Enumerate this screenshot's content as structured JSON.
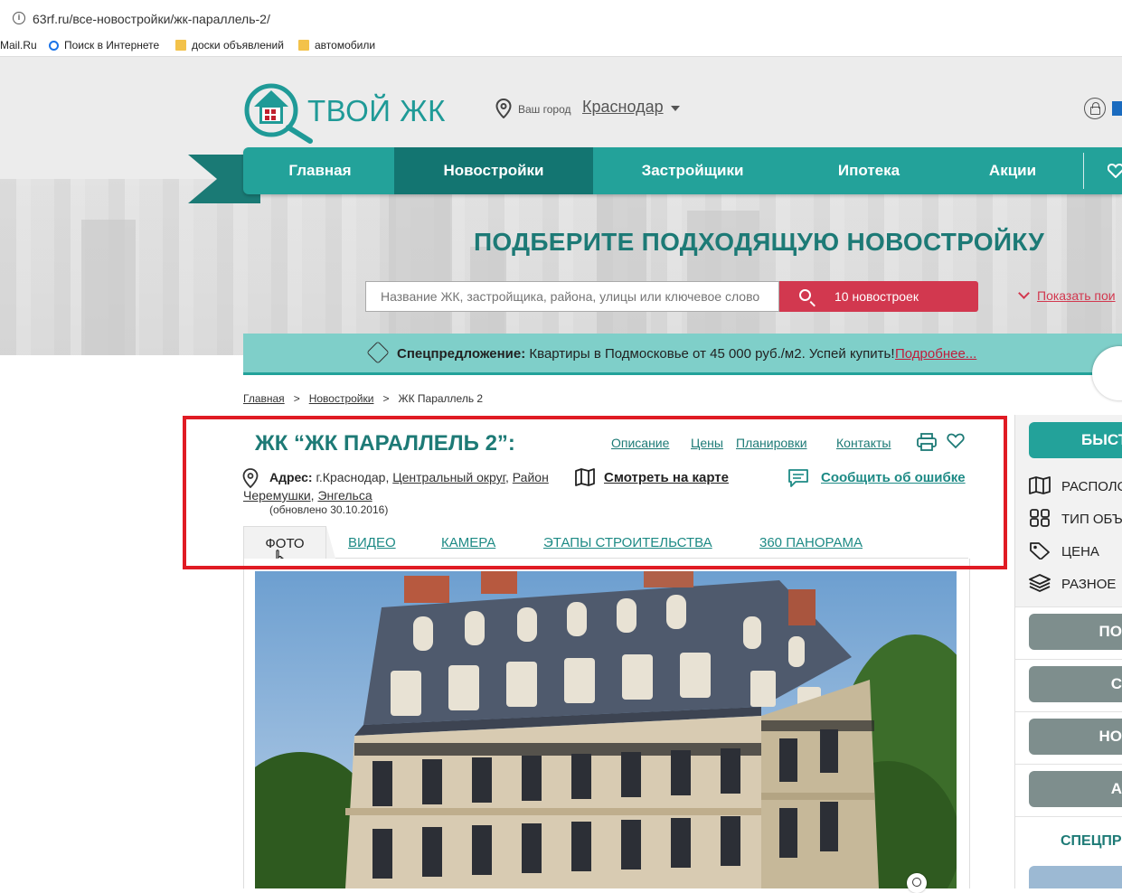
{
  "browser": {
    "url": "63rf.ru/все-новостройки/жк-параллель-2/",
    "bookmarks": [
      "Mail.Ru",
      "Поиск в Интернете",
      "доски объявлений",
      "автомобили"
    ]
  },
  "header": {
    "logo_text": "ТВОЙ ЖК",
    "city_label": "Ваш город",
    "city_name": "Краснодар"
  },
  "nav": {
    "items": [
      "Главная",
      "Новостройки",
      "Застройщики",
      "Ипотека",
      "Акции"
    ],
    "active": "Новостройки"
  },
  "hero": {
    "title": "ПОДБЕРИТЕ ПОДХОДЯЩУЮ НОВОСТРОЙКУ",
    "search_placeholder": "Название ЖК, застройщика, района, улицы или ключевое слово",
    "search_button": "10 новостроек",
    "show_more": "Показать пои"
  },
  "special": {
    "label": "Спецпредложение:",
    "text": " Квартиры в Подмосковье от 45 000 руб./м2. Успей купить!",
    "link": "Подробнее..."
  },
  "breadcrumb": [
    "Главная",
    "Новостройки",
    "ЖК Параллель 2"
  ],
  "complex": {
    "title": "ЖК “ЖК ПАРАЛЛЕЛЬ 2”:",
    "links": [
      "Описание",
      "Цены",
      "Планировки",
      "Контакты"
    ],
    "address_label": "Адрес:",
    "address_city": " г.Краснодар, ",
    "address_district": "Центральный округ",
    "address_area1": "Район",
    "address_area2": "Черемушки",
    "address_street": "Энгельса",
    "updated": "(обновлено 30.10.2016)",
    "map_link": "Смотреть на карте",
    "error_link": "Сообщить об ошибке"
  },
  "tabs": [
    "ФОТО",
    "ВИДЕО",
    "КАМЕРА",
    "ЭТАПЫ СТРОИТЕЛЬСТВА",
    "360 ПАНОРАМА"
  ],
  "sidebar": {
    "top_button": "БЫСТ",
    "filters": [
      "РАСПОЛО",
      "ТИП ОБЪ",
      "ЦЕНА",
      "РАЗНОЕ"
    ],
    "buttons": [
      "ПО",
      "С",
      "НО",
      "А"
    ],
    "spec_title": "СПЕЦПР"
  },
  "colors": {
    "teal": "#23a29a",
    "teal_dark": "#137571",
    "title_teal": "#1d7a76",
    "red": "#d2384f",
    "highlight": "#e01b24"
  }
}
